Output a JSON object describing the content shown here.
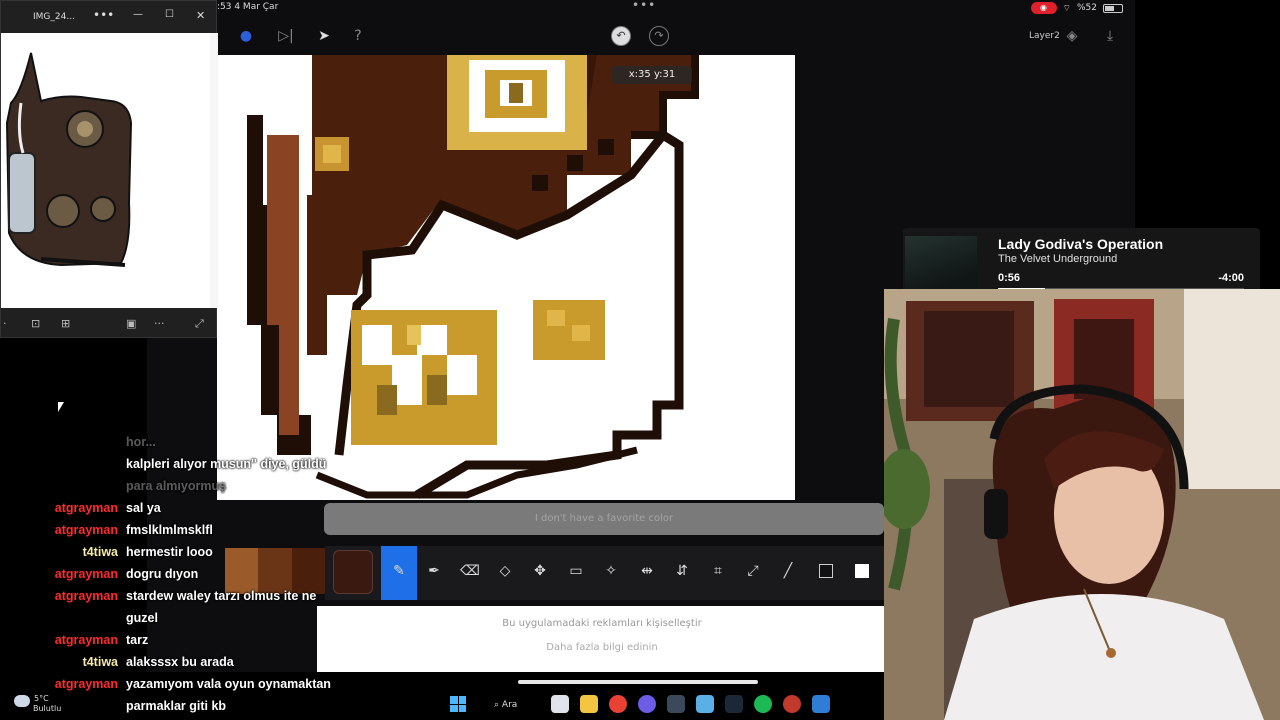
{
  "ipad": {
    "time": ":53  4 Mar Çar",
    "dots": "•••",
    "status": {
      "rec": "◉",
      "battery": "%52"
    },
    "toolbar": {
      "help": "?",
      "undo": "↶",
      "redo": "↷",
      "layer": "Layer2"
    },
    "coord_readout": "x:35 y:31",
    "ad_bar_text": "I don't have a favorite color",
    "ad_lower_line1": "Bu uygulamadaki reklamları kişiselleştir",
    "ad_lower_line2": "Daha fazla bilgi edinin",
    "current_color": "#3a1a10",
    "tool_accent": "#1f6fe8"
  },
  "photo_window": {
    "title": "IMG_24...",
    "more": "•••",
    "minimize": "—",
    "maximize": "☐",
    "close": "✕"
  },
  "chat": {
    "messages": [
      {
        "user": "",
        "text": "hor...",
        "user_color": "#ffffff",
        "faded": true
      },
      {
        "user": "",
        "text": "kalpleri alıyor musun\" diye, güldü",
        "user_color": "#ffffff",
        "faded": false
      },
      {
        "user": "",
        "text": "para almıyormuş",
        "user_color": "#ffffff",
        "faded": true
      },
      {
        "user": "atgrayman",
        "text": "sal ya",
        "user_color": "#ff2b2b",
        "faded": false
      },
      {
        "user": "atgrayman",
        "text": "fmslklmlmsklfl",
        "user_color": "#ff2b2b",
        "faded": false
      },
      {
        "user": "t4tiwa",
        "text": "hermestir looo",
        "user_color": "#f5e9a8",
        "faded": false
      },
      {
        "user": "atgrayman",
        "text": "dogru dıyon",
        "user_color": "#ff2b2b",
        "faded": false
      },
      {
        "user": "atgrayman",
        "text": "stardew waley tarzı olmus ite ne",
        "user_color": "#ff2b2b",
        "faded": false
      },
      {
        "user": "",
        "text": "guzel",
        "user_color": "#ffffff",
        "faded": false
      },
      {
        "user": "atgrayman",
        "text": "tarz",
        "user_color": "#ff2b2b",
        "faded": false
      },
      {
        "user": "t4tiwa",
        "text": "alaksssx bu arada",
        "user_color": "#f5e9a8",
        "faded": false
      },
      {
        "user": "atgrayman",
        "text": "yazamıyom vala oyun oynamaktan",
        "user_color": "#ff2b2b",
        "faded": false
      },
      {
        "user": "",
        "text": "parmaklar giti kb",
        "user_color": "#ffffff",
        "faded": false
      }
    ]
  },
  "music": {
    "title": "Lady Godiva's Operation",
    "artist": "The Velvet Underground",
    "elapsed": "0:56",
    "remaining": "-4:00",
    "progress": 0.19
  },
  "taskbar": {
    "weather_temp": "5°C",
    "weather_desc": "Bulutlu",
    "search_label": "Ara"
  }
}
